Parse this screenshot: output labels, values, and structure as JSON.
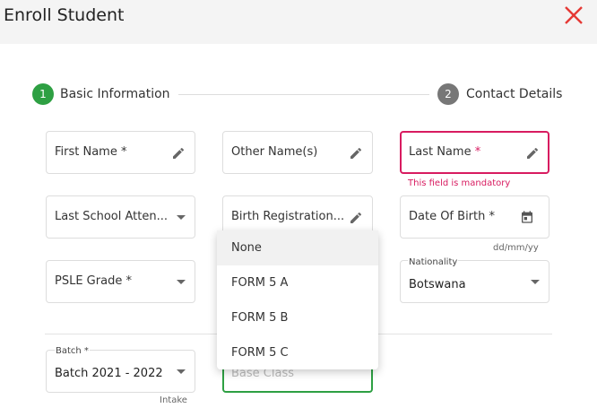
{
  "dialog": {
    "title": "Enroll Student"
  },
  "stepper": {
    "steps": [
      {
        "number": "1",
        "label": "Basic Information"
      },
      {
        "number": "2",
        "label": "Contact Details"
      }
    ]
  },
  "fields": {
    "first_name": {
      "label": "First Name *"
    },
    "other_names": {
      "label": "Other Name(s)"
    },
    "last_name": {
      "label": "Last Name",
      "required_mark": "*",
      "error": "This field is mandatory"
    },
    "last_school": {
      "label": "Last School Atten..."
    },
    "birth_registration": {
      "label": "Birth Registration..."
    },
    "date_of_birth": {
      "label": "Date Of Birth *",
      "hint": "dd/mm/yy"
    },
    "psle_grade": {
      "label": "PSLE Grade *"
    },
    "nationality": {
      "label": "Nationality",
      "value": "Botswana"
    },
    "batch": {
      "label": "Batch *",
      "value": "Batch 2021 - 2022",
      "hint": "Intake"
    },
    "base_class": {
      "placeholder": "Base Class"
    }
  },
  "dropdown": {
    "options": [
      "None",
      "FORM 5 A",
      "FORM 5 B",
      "FORM 5 C"
    ],
    "highlighted": "None"
  },
  "colors": {
    "accent": "#2ea043",
    "error": "#d81b60",
    "close": "#e53935"
  }
}
